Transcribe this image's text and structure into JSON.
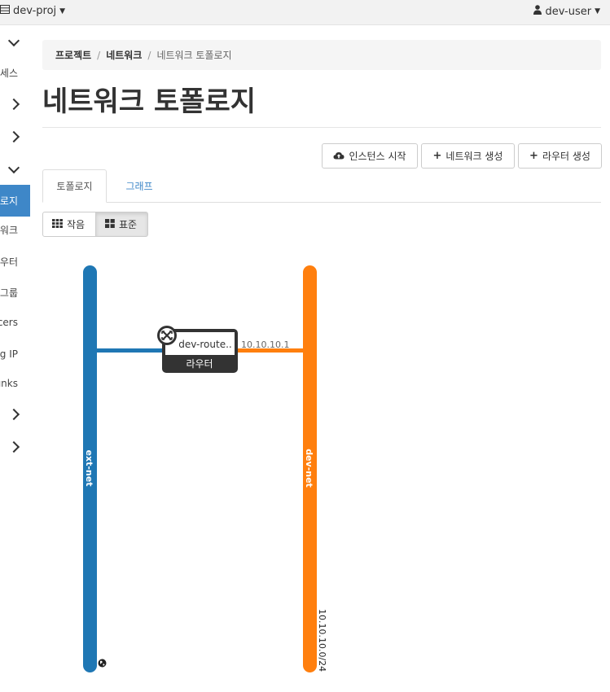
{
  "topbar": {
    "project": "dev-proj",
    "user": "dev-user"
  },
  "sidebar": {
    "items": [
      "세스",
      "로지",
      "워크",
      "우터",
      "그룹",
      "cers",
      "g IP",
      "unks"
    ]
  },
  "breadcrumb": {
    "item1": "프로젝트",
    "item2": "네트워크",
    "current": "네트워크 토폴로지"
  },
  "page": {
    "title": "네트워크 토폴로지"
  },
  "actions": {
    "launch_instance": "인스턴스 시작",
    "create_network": "네트워크 생성",
    "create_router": "라우터 생성"
  },
  "tabs": {
    "topology": "토폴로지",
    "graph": "그래프"
  },
  "view_toggle": {
    "small": "작음",
    "normal": "표준"
  },
  "topology": {
    "networks": [
      {
        "name": "ext-net",
        "color": "#1f77b4",
        "cidr": ""
      },
      {
        "name": "dev-net",
        "color": "#ff7f0e",
        "cidr": "10.10.10.0/24"
      }
    ],
    "router": {
      "name": "dev-route..",
      "type_label": "라우터",
      "port_ip": "10.10.10.1"
    }
  },
  "colors": {
    "accent": "#3e87c8",
    "router_dark": "#333333"
  }
}
